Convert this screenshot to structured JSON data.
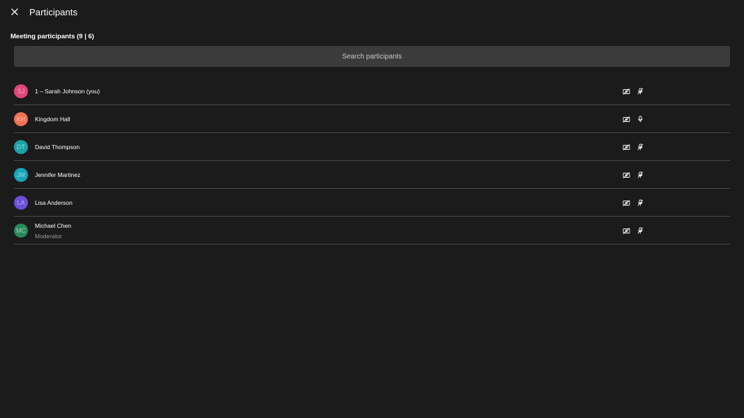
{
  "header": {
    "title": "Participants",
    "close_icon": "close-icon"
  },
  "section": {
    "title": "Meeting participants (9 | 6)"
  },
  "search": {
    "placeholder": "Search participants",
    "value": ""
  },
  "participants": [
    {
      "initials": "SJ",
      "name": "1 – Sarah Johnson (you)",
      "subtitle": "",
      "avatar_color": "#e0457a",
      "camera": "off",
      "mic": "muted"
    },
    {
      "initials": "KH",
      "name": "Kingdom Hall",
      "subtitle": "",
      "avatar_color": "#ef7154",
      "camera": "off",
      "mic": "on"
    },
    {
      "initials": "DT",
      "name": "David Thompson",
      "subtitle": "",
      "avatar_color": "#1aa3a8",
      "camera": "off",
      "mic": "muted"
    },
    {
      "initials": "JM",
      "name": "Jennifer Martinez",
      "subtitle": "",
      "avatar_color": "#17a5b8",
      "camera": "off",
      "mic": "muted"
    },
    {
      "initials": "LA",
      "name": "Lisa Anderson",
      "subtitle": "",
      "avatar_color": "#6b4fd6",
      "camera": "off",
      "mic": "muted"
    },
    {
      "initials": "MC",
      "name": "Michael Chen",
      "subtitle": "Moderator",
      "avatar_color": "#2a8a5c",
      "camera": "off",
      "mic": "muted"
    }
  ],
  "colors": {
    "background": "#1b1b1b",
    "search_bg": "#3b3b3b",
    "divider": "#4a4a4a"
  }
}
